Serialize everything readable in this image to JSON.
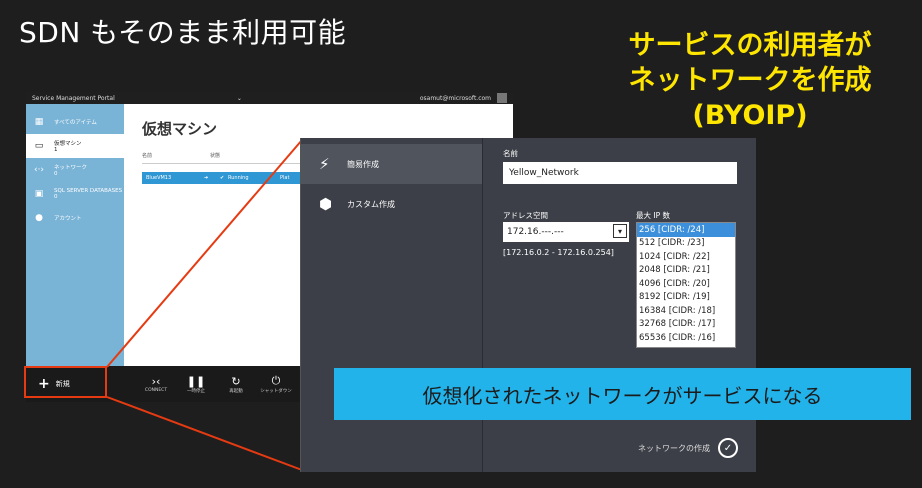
{
  "slide": {
    "title": "SDN もそのまま利用可能",
    "callout_line1": "サービスの利用者が",
    "callout_line2": "ネットワークを作成",
    "callout_line3": "(BYOIP)",
    "banner": "仮想化されたネットワークがサービスになる"
  },
  "portal": {
    "title": "Service Management Portal",
    "user": "osamut@microsoft.com",
    "nav": [
      {
        "label": "すべてのアイテム",
        "icon": "grid-icon"
      },
      {
        "label": "仮想マシン",
        "count": "1",
        "icon": "monitor-icon"
      },
      {
        "label": "ネットワーク",
        "count": "0",
        "icon": "network-icon"
      },
      {
        "label": "SQL SERVER DATABASES",
        "count": "0",
        "icon": "database-icon"
      },
      {
        "label": "アカウント",
        "icon": "person-icon"
      }
    ],
    "page_title": "仮想マシン",
    "columns": [
      "名前",
      "状態"
    ],
    "row": {
      "name": "BlueVM13",
      "status": "Running",
      "extra": "Plat"
    },
    "new_label": "新規",
    "actions": [
      "CONNECT",
      "一時停止",
      "再起動",
      "シャットダウン"
    ]
  },
  "dialog": {
    "nav": [
      {
        "label": "簡易作成",
        "icon": "lightning-icon"
      },
      {
        "label": "カスタム作成",
        "icon": "cube-icon"
      }
    ],
    "name_label": "名前",
    "name_value": "Yellow_Network",
    "address_label": "アドレス空間",
    "address_value": "172.16.---.---",
    "address_range": "[172.16.0.2 - 172.16.0.254]",
    "maxip_label": "最大 IP 数",
    "ip_options": [
      "256 [CIDR: /24]",
      "512 [CIDR: /23]",
      "1024 [CIDR: /22]",
      "2048 [CIDR: /21]",
      "4096 [CIDR: /20]",
      "8192 [CIDR: /19]",
      "16384 [CIDR: /18]",
      "32768 [CIDR: /17]",
      "65536 [CIDR: /16]"
    ],
    "create_label": "ネットワークの作成"
  },
  "colors": {
    "accent_yellow": "#ffe600",
    "banner_blue": "#22b3ea",
    "highlight_red": "#e63b12",
    "portal_nav": "#79b3d6"
  }
}
